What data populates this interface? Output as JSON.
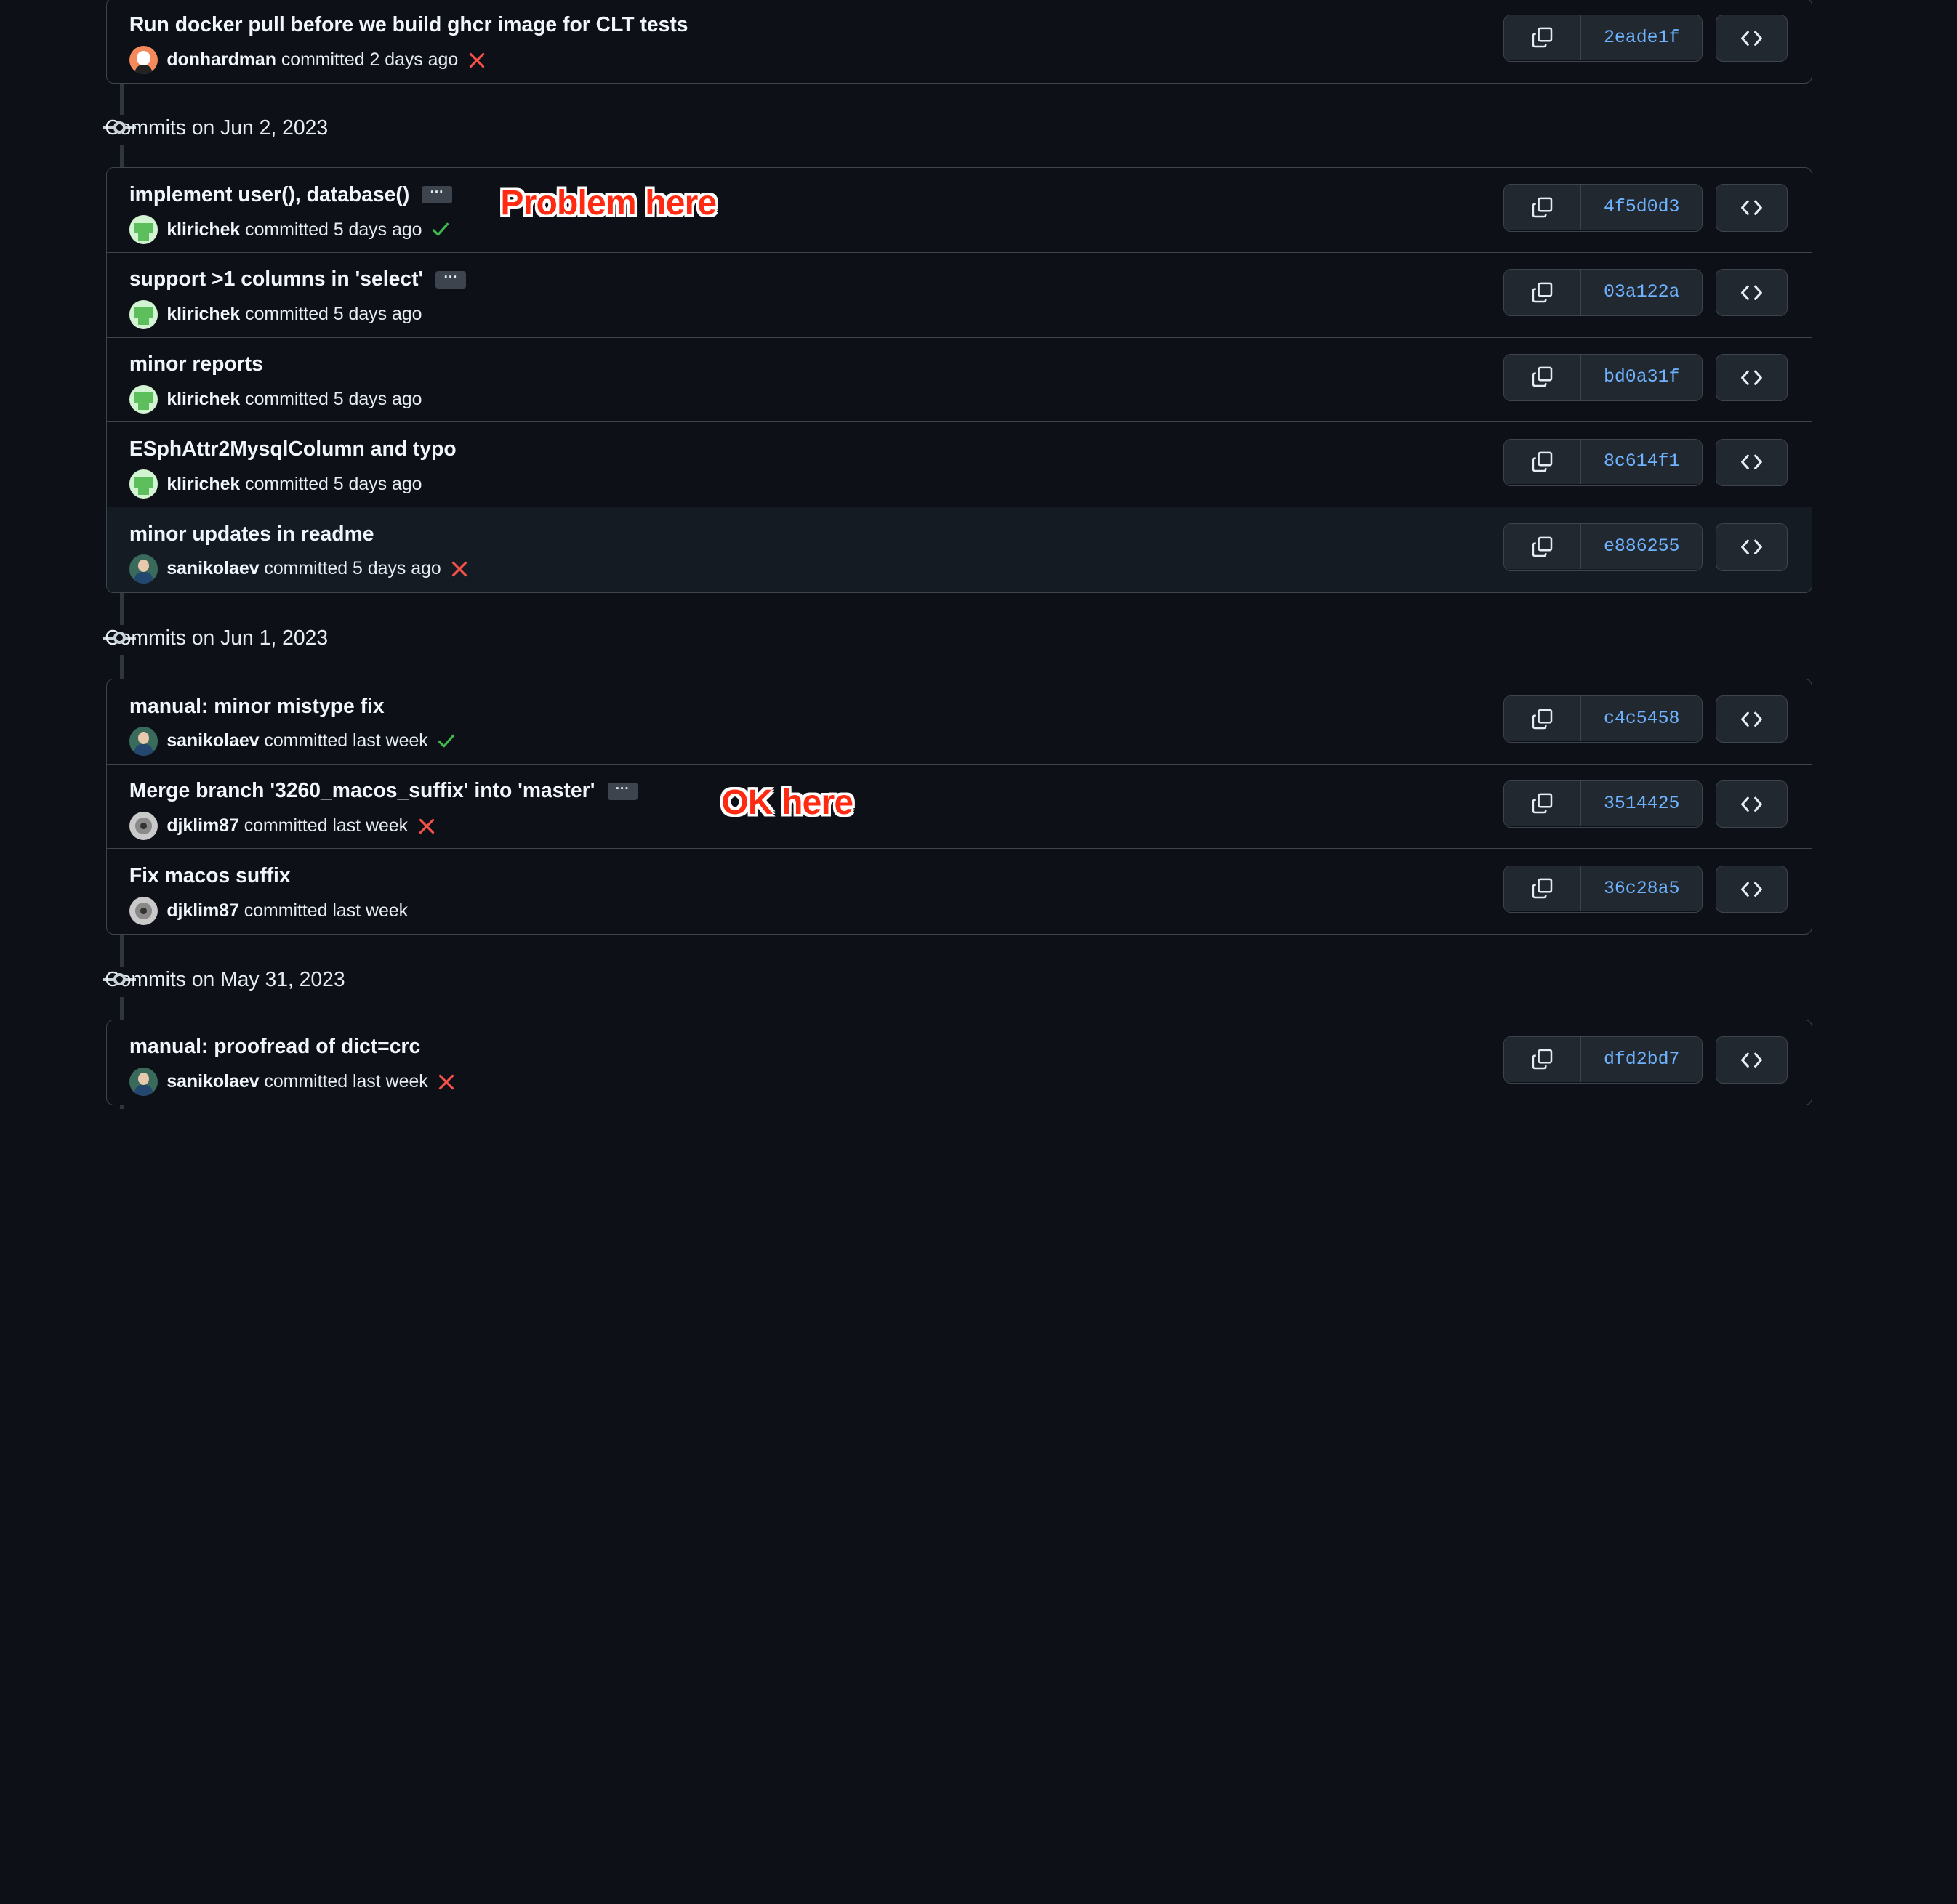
{
  "top_box": {
    "commits": [
      {
        "title": "Run docker pull before we build ghcr image for CLT tests",
        "author": "donhardman",
        "committed": "committed 2 days ago",
        "status": "fail",
        "avatar": "orange",
        "sha": "2eade1f",
        "has_ellipsis": false
      }
    ]
  },
  "groups": [
    {
      "title": "Commits on Jun 2, 2023",
      "commits": [
        {
          "title": "implement user(), database()",
          "author": "klirichek",
          "committed": "committed 5 days ago",
          "status": "success",
          "avatar": "green",
          "sha": "4f5d0d3",
          "has_ellipsis": true
        },
        {
          "title": "support >1 columns in 'select'",
          "author": "klirichek",
          "committed": "committed 5 days ago",
          "status": "none",
          "avatar": "green",
          "sha": "03a122a",
          "has_ellipsis": true
        },
        {
          "title": "minor reports",
          "author": "klirichek",
          "committed": "committed 5 days ago",
          "status": "none",
          "avatar": "green",
          "sha": "bd0a31f",
          "has_ellipsis": false
        },
        {
          "title": "ESphAttr2MysqlColumn and typo",
          "author": "klirichek",
          "committed": "committed 5 days ago",
          "status": "none",
          "avatar": "green",
          "sha": "8c614f1",
          "has_ellipsis": false
        },
        {
          "title": "minor updates in readme",
          "author": "sanikolaev",
          "committed": "committed 5 days ago",
          "status": "fail",
          "avatar": "blue",
          "sha": "e886255",
          "has_ellipsis": false,
          "highlighted": true
        }
      ]
    },
    {
      "title": "Commits on Jun 1, 2023",
      "commits": [
        {
          "title": "manual: minor mistype fix",
          "author": "sanikolaev",
          "committed": "committed last week",
          "status": "success",
          "avatar": "blue",
          "sha": "c4c5458",
          "has_ellipsis": false
        },
        {
          "title": "Merge branch '3260_macos_suffix' into 'master'",
          "author": "djklim87",
          "committed": "committed last week",
          "status": "fail",
          "avatar": "gray",
          "sha": "3514425",
          "has_ellipsis": true
        },
        {
          "title": "Fix macos suffix",
          "author": "djklim87",
          "committed": "committed last week",
          "status": "none",
          "avatar": "gray",
          "sha": "36c28a5",
          "has_ellipsis": false
        }
      ]
    },
    {
      "title": "Commits on May 31, 2023",
      "commits": [
        {
          "title": "manual: proofread of dict=crc",
          "author": "sanikolaev",
          "committed": "committed last week",
          "status": "fail",
          "avatar": "blue",
          "sha": "dfd2bd7",
          "has_ellipsis": false
        }
      ]
    }
  ],
  "annotations": {
    "problem": "Problem here",
    "ok": "OK here"
  },
  "colors": {
    "background": "#0d1117",
    "sha_link": "#6fb3ff",
    "success": "#3fb950",
    "fail": "#f85149",
    "annotation": "#ff2a12"
  },
  "icons": {
    "copy": "copy-icon",
    "browse": "code-icon",
    "timeline": "git-commit-icon"
  }
}
